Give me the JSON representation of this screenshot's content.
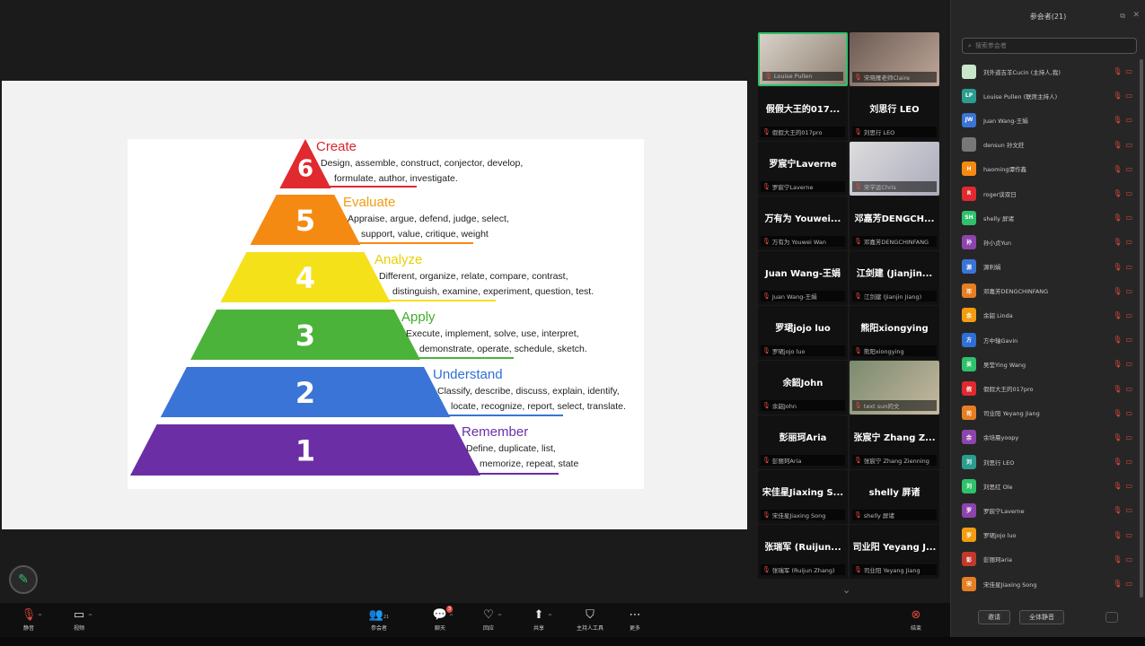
{
  "colors": {
    "accent_green": "#2fc26b",
    "mute_red": "#e04a3f"
  },
  "slide": {
    "levels": [
      {
        "number": "6",
        "title": "Create",
        "title_color": "#d9252e",
        "fill": "#e02a2f",
        "desc": [
          "Design, assemble, construct, conjector, develop,",
          "formulate, author, investigate."
        ]
      },
      {
        "number": "5",
        "title": "Evaluate",
        "title_color": "#f39c12",
        "fill": "#f58a12",
        "desc": [
          "Appraise, argue, defend, judge, select,",
          "support, value, critique, weight"
        ]
      },
      {
        "number": "4",
        "title": "Analyze",
        "title_color": "#e8d000",
        "fill": "#f5e11a",
        "desc": [
          "Different, organize, relate, compare, contrast,",
          "distinguish, examine, experiment, question, test."
        ]
      },
      {
        "number": "3",
        "title": "Apply",
        "title_color": "#3dae2b",
        "fill": "#4cb33a",
        "desc": [
          "Execute, implement, solve, use, interpret,",
          "demonstrate, operate, schedule, sketch."
        ]
      },
      {
        "number": "2",
        "title": "Understand",
        "title_color": "#2f6fd6",
        "fill": "#3a74d6",
        "desc": [
          "Classify, describe, discuss, explain, identify,",
          "locate, recognize, report, select, translate."
        ]
      },
      {
        "number": "1",
        "title": "Remember",
        "title_color": "#6a2fa8",
        "fill": "#6b2ea5",
        "desc": [
          "Define, duplicate, list,",
          "memorize, repeat, state"
        ]
      }
    ]
  },
  "gallery": {
    "tiles": [
      {
        "name": "",
        "sub": "Louise Pullen",
        "video": true,
        "active": true
      },
      {
        "name": "",
        "sub": "宋晓雁老师Claire",
        "video": true
      },
      {
        "name": "假假大王的017...",
        "sub": "假假大王的017pro"
      },
      {
        "name": "刘思行 LEO",
        "sub": "刘思行 LEO"
      },
      {
        "name": "罗宸宁Laverne",
        "sub": "罗宸宁Laverne"
      },
      {
        "name": "",
        "sub": "宋学运Chris",
        "video": true
      },
      {
        "name": "万有为 Youwei...",
        "sub": "万有为 Youwei Wan"
      },
      {
        "name": "邓嘉芳DENGCH...",
        "sub": "邓嘉芳DENGCHINFANG"
      },
      {
        "name": "Juan Wang-王娟",
        "sub": "Juan Wang-王娟"
      },
      {
        "name": "江剑建 (Jianjin...",
        "sub": "江剑建 (Jianjin Jiang)"
      },
      {
        "name": "罗珺jojo luo",
        "sub": "罗珺jojo luo"
      },
      {
        "name": "熊阳xiongying",
        "sub": "熊阳xiongying"
      },
      {
        "name": "余韶John",
        "sub": "余韶John"
      },
      {
        "name": "",
        "sub": "text sun的文",
        "video": true
      },
      {
        "name": "彭丽珂Aria",
        "sub": "彭丽珂Aria"
      },
      {
        "name": "张宸宁 Zhang Z...",
        "sub": "张宸宁 Zhang Zienning"
      },
      {
        "name": "宋佳星Jiaxing S...",
        "sub": "宋佳星Jiaxing Song"
      },
      {
        "name": "shelly 屏诸",
        "sub": "shelly 屏诸"
      },
      {
        "name": "张瑞军 (Ruijun...",
        "sub": "张瑞军 (Ruijun Zhang)"
      },
      {
        "name": "司业阳 Yeyang J...",
        "sub": "司业阳 Yeyang Jiang"
      }
    ]
  },
  "panel": {
    "title": "参会者(21)",
    "search_placeholder": "搜索参会者",
    "participants": [
      {
        "name": "刘外道吉羊Cucin (主持人,我)",
        "av": "",
        "color": "#c8e6c9"
      },
      {
        "name": "Louise Pullen (联席主持人)",
        "av": "LP",
        "color": "#2a9d8f"
      },
      {
        "name": "Juan Wang-王娟",
        "av": "JW",
        "color": "#3a74d6"
      },
      {
        "name": "densun 孙文莊",
        "av": "",
        "color": "#777"
      },
      {
        "name": "haoming谭作鑫",
        "av": "H",
        "color": "#f58a12"
      },
      {
        "name": "roger谈双日",
        "av": "R",
        "color": "#e02a2f"
      },
      {
        "name": "shelly 屏诸",
        "av": "SH",
        "color": "#2fc26b"
      },
      {
        "name": "孙小贞Yun",
        "av": "孙",
        "color": "#8e44ad"
      },
      {
        "name": "源利娟",
        "av": "源",
        "color": "#3a74d6"
      },
      {
        "name": "邓嘉芳DENGCHINFANG",
        "av": "邓",
        "color": "#e67e22"
      },
      {
        "name": "余韶 Linda",
        "av": "余",
        "color": "#f39c12"
      },
      {
        "name": "方中轴Gavin",
        "av": "方",
        "color": "#2f6fd6"
      },
      {
        "name": "吴莹Ying Wang",
        "av": "吴",
        "color": "#2fc26b"
      },
      {
        "name": "假假大王的017pro",
        "av": "假",
        "color": "#e02a2f"
      },
      {
        "name": "司业阳 Yeyang Jiang",
        "av": "司",
        "color": "#e67e22"
      },
      {
        "name": "余培晨yoopy",
        "av": "余",
        "color": "#8e44ad"
      },
      {
        "name": "刘思行 LEO",
        "av": "刘",
        "color": "#2a9d8f"
      },
      {
        "name": "刘思红 Ole",
        "av": "刘",
        "color": "#2fc26b"
      },
      {
        "name": "罗宸宁Laverne",
        "av": "罗",
        "color": "#8e44ad"
      },
      {
        "name": "罗珺jojo luo",
        "av": "罗",
        "color": "#f39c12"
      },
      {
        "name": "彭丽珂aria",
        "av": "彭",
        "color": "#c0392b"
      },
      {
        "name": "宋佳星Jiaxing Song",
        "av": "宋",
        "color": "#e67e22"
      }
    ],
    "footer": {
      "invite": "邀请",
      "mute_all": "全体静音"
    }
  },
  "toolbar": {
    "mute": "静音",
    "video": "视频",
    "participants": "参会者",
    "participants_count": "21",
    "chat": "聊天",
    "chat_badge": "3",
    "react": "回应",
    "share": "共享",
    "host_tools": "主持人工具",
    "more": "更多",
    "end": "结束"
  }
}
